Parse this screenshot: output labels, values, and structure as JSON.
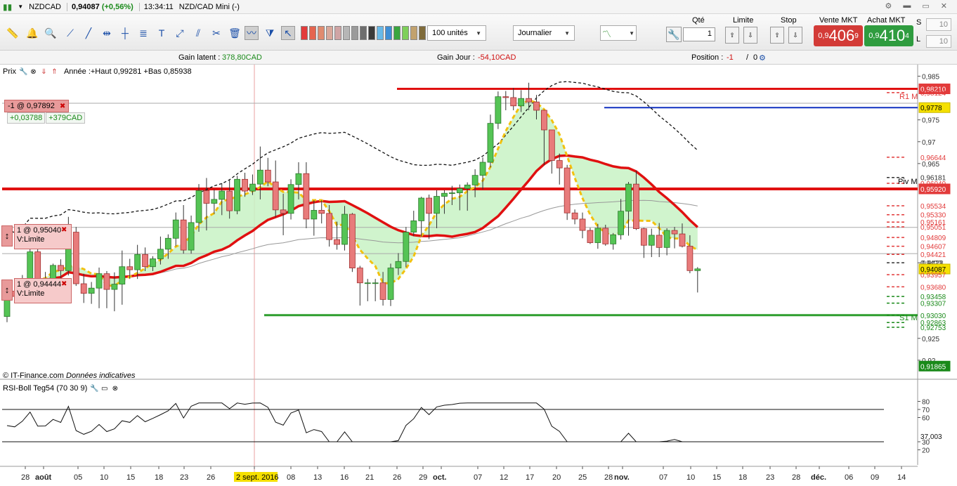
{
  "titlebar": {
    "symbol": "NZDCAD",
    "price": "0,94087",
    "change": "(+0,56%)",
    "time": "13:34:11",
    "instrument": "NZD/CAD Mini (-)"
  },
  "toolbar": {
    "units_select": "100 unités",
    "period_select": "Journalier",
    "qty_label": "Qté",
    "qty_value": "1",
    "limit_label": "Limite",
    "stop_label": "Stop",
    "sell_label": "Vente MKT",
    "buy_label": "Achat MKT",
    "sell_prefix": "0,9",
    "sell_big": "406",
    "sell_sup": "9",
    "buy_prefix": "0,9",
    "buy_big": "410",
    "buy_sup": "4",
    "s_label": "S",
    "s_value": "10",
    "l_label": "L",
    "l_value": "10",
    "swatch_colors": [
      "#e23b3b",
      "#e5654f",
      "#e08b6f",
      "#d9a89a",
      "#cfa4a4",
      "#b6b6b6",
      "#9b9b9b",
      "#6e6e6e",
      "#3a3a3a",
      "#68b9e8",
      "#3f8fd6",
      "#3aa63f",
      "#7ecf5a",
      "#c2a26e",
      "#7f6b3a"
    ]
  },
  "infobar": {
    "gain_latent_label": "Gain latent :",
    "gain_latent_value": "378,80CAD",
    "gain_jour_label": "Gain Jour :",
    "gain_jour_value": "-54,10CAD",
    "position_label": "Position :",
    "position_value": "-1",
    "position_sep": "/",
    "position_zero": "0"
  },
  "price_pane": {
    "label": "Prix",
    "year_info": "Année :+Haut 0,99281 +Bas 0,85938",
    "order_tag": "-1 @ 0,97892",
    "order_pl_price": "+0,03788",
    "order_pl_cad": "+379CAD",
    "limit1_tag": "1 @ 0,95040",
    "limit1_type": "V:Limite",
    "limit2_tag": "1 @ 0,94444",
    "limit2_type": "V:Limite",
    "watermark": "© IT-Finance.com",
    "watermark_note": "Données indicatives",
    "piv_label": "Piv M",
    "r1_label": "R1 M",
    "s1_label": "S1 M"
  },
  "rsi_pane": {
    "label": "RSI-Boll Teg54 (70 30 9)"
  },
  "chart_data": {
    "type": "candlestick",
    "ylim": [
      0.915,
      0.987
    ],
    "y_ticks": [
      "0,985",
      "0,975",
      "0,97",
      "0,965",
      "0,9423",
      "0,925",
      "0,92"
    ],
    "candles": [
      [
        0.93,
        0.9362,
        0.9287,
        0.9358
      ],
      [
        0.9358,
        0.9379,
        0.9342,
        0.9346
      ],
      [
        0.9346,
        0.9395,
        0.9342,
        0.9383
      ],
      [
        0.9383,
        0.9463,
        0.9371,
        0.9448
      ],
      [
        0.9448,
        0.9462,
        0.9365,
        0.9381
      ],
      [
        0.9381,
        0.9402,
        0.9365,
        0.9381
      ],
      [
        0.9381,
        0.9421,
        0.9381,
        0.9417
      ],
      [
        0.9417,
        0.9431,
        0.9381,
        0.9405
      ],
      [
        0.9405,
        0.9528,
        0.9394,
        0.9493
      ],
      [
        0.9493,
        0.9505,
        0.937,
        0.9375
      ],
      [
        0.9375,
        0.9398,
        0.9331,
        0.9353
      ],
      [
        0.9353,
        0.9379,
        0.9329,
        0.9365
      ],
      [
        0.9365,
        0.9412,
        0.9319,
        0.9398
      ],
      [
        0.9398,
        0.9404,
        0.9319,
        0.9362
      ],
      [
        0.9362,
        0.9401,
        0.9312,
        0.9374
      ],
      [
        0.9374,
        0.9451,
        0.9327,
        0.9414
      ],
      [
        0.9414,
        0.9432,
        0.9386,
        0.9407
      ],
      [
        0.9407,
        0.9464,
        0.9386,
        0.9442
      ],
      [
        0.9442,
        0.9458,
        0.9404,
        0.9414
      ],
      [
        0.9414,
        0.9438,
        0.9404,
        0.9432
      ],
      [
        0.9432,
        0.9483,
        0.9419,
        0.9454
      ],
      [
        0.9454,
        0.9488,
        0.9432,
        0.9479
      ],
      [
        0.9479,
        0.9538,
        0.9461,
        0.9521
      ],
      [
        0.9521,
        0.9555,
        0.9444,
        0.9452
      ],
      [
        0.9452,
        0.9531,
        0.9444,
        0.9515
      ],
      [
        0.9515,
        0.9603,
        0.9494,
        0.9588
      ],
      [
        0.9588,
        0.9617,
        0.9497,
        0.9559
      ],
      [
        0.9559,
        0.9591,
        0.9535,
        0.9568
      ],
      [
        0.9568,
        0.9605,
        0.9532,
        0.9587
      ],
      [
        0.9587,
        0.9612,
        0.9524,
        0.9542
      ],
      [
        0.9542,
        0.9622,
        0.9534,
        0.9614
      ],
      [
        0.9614,
        0.9629,
        0.9574,
        0.9587
      ],
      [
        0.9587,
        0.9625,
        0.9578,
        0.9603
      ],
      [
        0.9603,
        0.9689,
        0.9568,
        0.9635
      ],
      [
        0.9635,
        0.9663,
        0.9598,
        0.9608
      ],
      [
        0.9608,
        0.9657,
        0.9527,
        0.9544
      ],
      [
        0.9544,
        0.9581,
        0.9486,
        0.9536
      ],
      [
        0.9536,
        0.9614,
        0.9522,
        0.9602
      ],
      [
        0.9602,
        0.9653,
        0.9568,
        0.9627
      ],
      [
        0.9627,
        0.9653,
        0.9502,
        0.9523
      ],
      [
        0.9523,
        0.9566,
        0.9485,
        0.9543
      ],
      [
        0.9543,
        0.9566,
        0.9513,
        0.9536
      ],
      [
        0.9536,
        0.9555,
        0.946,
        0.9476
      ],
      [
        0.9476,
        0.9517,
        0.9453,
        0.9465
      ],
      [
        0.9465,
        0.9553,
        0.9451,
        0.9534
      ],
      [
        0.9534,
        0.9537,
        0.9402,
        0.9411
      ],
      [
        0.9411,
        0.9416,
        0.9325,
        0.9377
      ],
      [
        0.9377,
        0.9386,
        0.9335,
        0.9377
      ],
      [
        0.9377,
        0.9386,
        0.9335,
        0.9377
      ],
      [
        0.9377,
        0.9402,
        0.9325,
        0.9339
      ],
      [
        0.9339,
        0.9421,
        0.9324,
        0.9411
      ],
      [
        0.9411,
        0.9445,
        0.9395,
        0.9426
      ],
      [
        0.9426,
        0.9505,
        0.9413,
        0.9493
      ],
      [
        0.9493,
        0.9542,
        0.9484,
        0.9519
      ],
      [
        0.9519,
        0.9574,
        0.9483,
        0.9571
      ],
      [
        0.9571,
        0.9579,
        0.9477,
        0.9536
      ],
      [
        0.9536,
        0.9589,
        0.9502,
        0.9575
      ],
      [
        0.9575,
        0.9589,
        0.9535,
        0.9582
      ],
      [
        0.9582,
        0.9599,
        0.9555,
        0.9583
      ],
      [
        0.9583,
        0.9602,
        0.9543,
        0.9593
      ],
      [
        0.9593,
        0.9607,
        0.9542,
        0.9601
      ],
      [
        0.9601,
        0.9637,
        0.9573,
        0.9623
      ],
      [
        0.9623,
        0.9664,
        0.9591,
        0.9653
      ],
      [
        0.9653,
        0.9762,
        0.9641,
        0.9742
      ],
      [
        0.9742,
        0.9815,
        0.9729,
        0.9803
      ],
      [
        0.9803,
        0.9816,
        0.9772,
        0.9801
      ],
      [
        0.9801,
        0.9823,
        0.9772,
        0.9782
      ],
      [
        0.9782,
        0.9818,
        0.9768,
        0.9799
      ],
      [
        0.9799,
        0.9835,
        0.9772,
        0.9791
      ],
      [
        0.9791,
        0.9807,
        0.9751,
        0.9772
      ],
      [
        0.9772,
        0.9773,
        0.9646,
        0.9727
      ],
      [
        0.9727,
        0.9727,
        0.9627,
        0.9657
      ],
      [
        0.9657,
        0.9673,
        0.9602,
        0.964
      ],
      [
        0.964,
        0.9647,
        0.9521,
        0.9537
      ],
      [
        0.9537,
        0.9545,
        0.9511,
        0.9523
      ],
      [
        0.9523,
        0.9538,
        0.9479,
        0.9497
      ],
      [
        0.9497,
        0.9503,
        0.9466,
        0.9469
      ],
      [
        0.9469,
        0.9512,
        0.9455,
        0.9502
      ],
      [
        0.9502,
        0.951,
        0.9462,
        0.9466
      ],
      [
        0.9466,
        0.9491,
        0.9453,
        0.9487
      ],
      [
        0.9487,
        0.9569,
        0.9476,
        0.9541
      ],
      [
        0.9541,
        0.9608,
        0.9485,
        0.9603
      ],
      [
        0.9603,
        0.9634,
        0.9498,
        0.9501
      ],
      [
        0.9501,
        0.9503,
        0.9434,
        0.9463
      ],
      [
        0.9463,
        0.9501,
        0.9436,
        0.9486
      ],
      [
        0.9486,
        0.9514,
        0.9436,
        0.9458
      ],
      [
        0.9458,
        0.9502,
        0.944,
        0.9497
      ],
      [
        0.9497,
        0.9505,
        0.9456,
        0.9489
      ],
      [
        0.9489,
        0.9513,
        0.9458,
        0.9461
      ],
      [
        0.9461,
        0.9486,
        0.9399,
        0.9405
      ],
      [
        0.9405,
        0.9413,
        0.9355,
        0.9409
      ]
    ],
    "price_labels": [
      {
        "text": "0,98210",
        "color": "#e23b3b",
        "kind": "box"
      },
      {
        "text": "0,98124",
        "color": "#e23b3b",
        "kind": "text"
      },
      {
        "text": "0,9778",
        "color": "#f5e000",
        "kind": "box"
      },
      {
        "text": "0,96644",
        "color": "#e23b3b",
        "kind": "text"
      },
      {
        "text": "0,96181",
        "color": "#333333",
        "kind": "text"
      },
      {
        "text": "0,96049",
        "color": "#e23b3b",
        "kind": "text"
      },
      {
        "text": "0,95920",
        "color": "#e23b3b",
        "kind": "box"
      },
      {
        "text": "0,95534",
        "color": "#e23b3b",
        "kind": "text"
      },
      {
        "text": "0,95330",
        "color": "#e23b3b",
        "kind": "text"
      },
      {
        "text": "0,95161",
        "color": "#e23b3b",
        "kind": "text"
      },
      {
        "text": "0,95051",
        "color": "#e23b3b",
        "kind": "text"
      },
      {
        "text": "0,94809",
        "color": "#e23b3b",
        "kind": "text"
      },
      {
        "text": "0,94607",
        "color": "#e23b3b",
        "kind": "text"
      },
      {
        "text": "0,94421",
        "color": "#e23b3b",
        "kind": "text"
      },
      {
        "text": "0,9423",
        "color": "#333333",
        "kind": "text"
      },
      {
        "text": "0,94087",
        "color": "#f5e000",
        "kind": "box"
      },
      {
        "text": "0,93957",
        "color": "#e23b3b",
        "kind": "text"
      },
      {
        "text": "0,93680",
        "color": "#e23b3b",
        "kind": "text"
      },
      {
        "text": "0,93458",
        "color": "#1a8a1a",
        "kind": "text"
      },
      {
        "text": "0,93307",
        "color": "#1a8a1a",
        "kind": "text"
      },
      {
        "text": "0,93030",
        "color": "#1a8a1a",
        "kind": "text"
      },
      {
        "text": "0,92863",
        "color": "#1a8a1a",
        "kind": "text"
      },
      {
        "text": "0,92753",
        "color": "#1a8a1a",
        "kind": "text"
      },
      {
        "text": "0,91865",
        "color": "#1a8a1a",
        "kind": "box"
      }
    ],
    "rsi_ticks": [
      "80",
      "70",
      "60",
      "37,003",
      "30",
      "20"
    ],
    "x_labels": [
      "28",
      "août",
      "05",
      "10",
      "15",
      "18",
      "23",
      "26",
      "2 sept. 2016",
      "08",
      "13",
      "16",
      "21",
      "26",
      "29",
      "oct.",
      "07",
      "12",
      "17",
      "20",
      "25",
      "28",
      "nov.",
      "07",
      "10",
      "15",
      "18",
      "23",
      "28",
      "déc.",
      "06",
      "09",
      "14"
    ]
  }
}
